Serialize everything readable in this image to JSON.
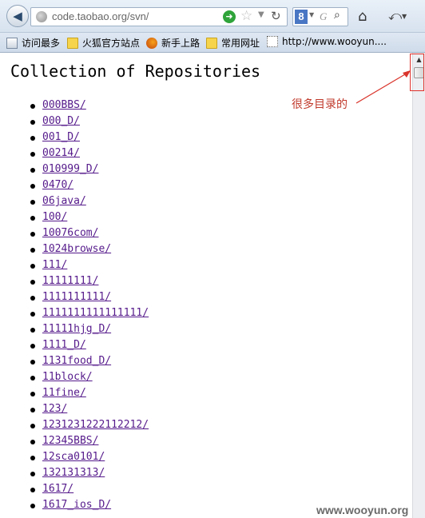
{
  "browser": {
    "url": "code.taobao.org/svn/",
    "search_placeholder": "G",
    "bookmarks": [
      {
        "label": "访问最多",
        "icon": "bookmark-icon"
      },
      {
        "label": "火狐官方站点",
        "icon": "folder-icon"
      },
      {
        "label": "新手上路",
        "icon": "firefox-icon"
      },
      {
        "label": "常用网址",
        "icon": "folder-icon"
      },
      {
        "label": "http://www.wooyun....",
        "icon": "blank-page-icon"
      }
    ]
  },
  "page": {
    "title": "Collection of Repositories",
    "repositories": [
      "000BBS/",
      "000_D/",
      "001_D/",
      "00214/",
      "010999_D/",
      "0470/",
      "06java/",
      "100/",
      "10076com/",
      "1024browse/",
      "111/",
      "11111111/",
      "1111111111/",
      "1111111111111111/",
      "11111hjg_D/",
      "1111_D/",
      "1131food_D/",
      "11block/",
      "11fine/",
      "123/",
      "1231231222112212/",
      "12345BBS/",
      "12sca0101/",
      "132131313/",
      "1617/",
      "1617_ios_D/"
    ]
  },
  "annotation": {
    "text": "很多目录的",
    "color": "#c0392b"
  },
  "watermark": "www.wooyun.org",
  "colors": {
    "link_visited": "#551a8b",
    "annotation_red": "#e0322c"
  }
}
